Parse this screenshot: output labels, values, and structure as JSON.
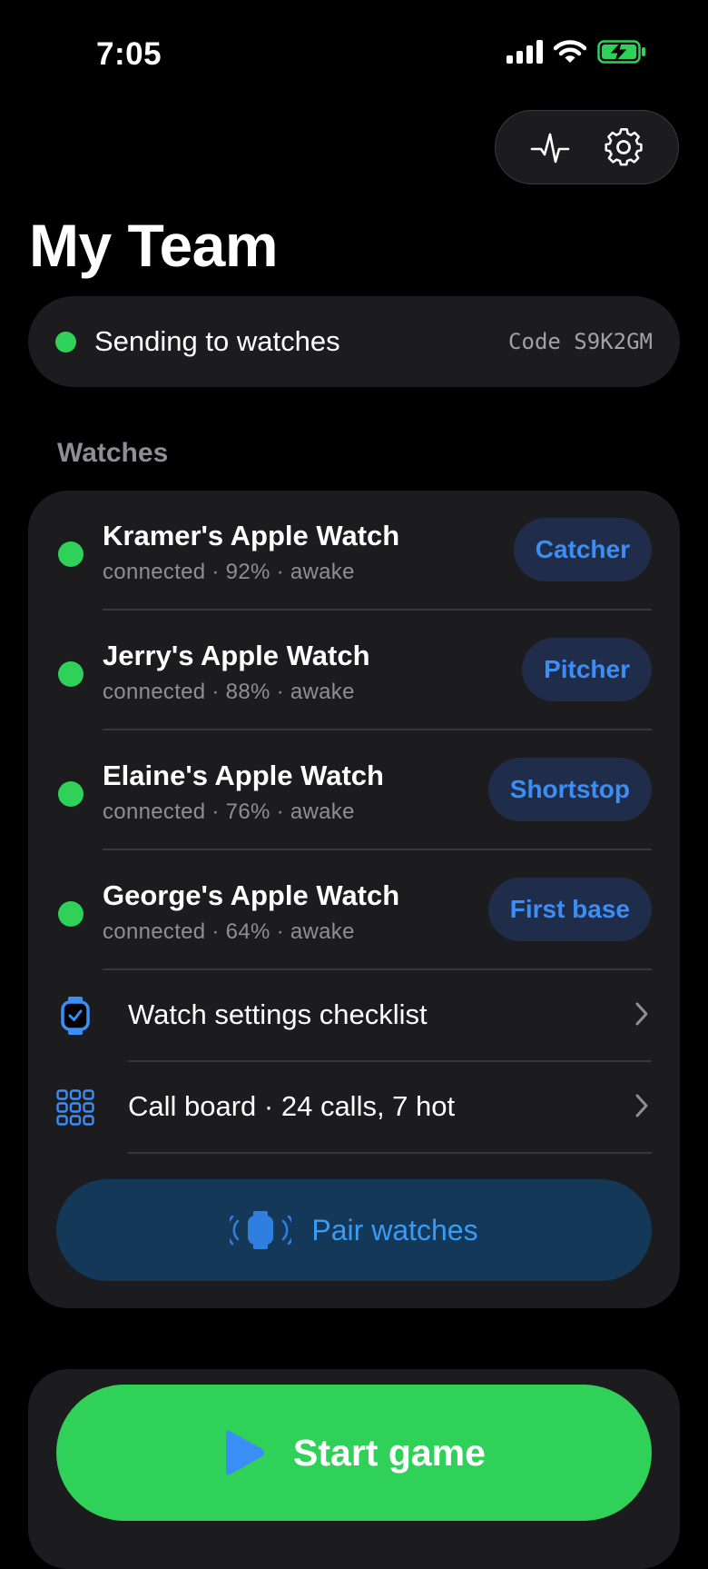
{
  "status_bar": {
    "time": "7:05"
  },
  "header": {
    "title": "My Team"
  },
  "broadcast": {
    "status": "Sending to watches",
    "code": "Code S9K2GM",
    "status_color": "#30d158"
  },
  "watches_section": {
    "label": "Watches",
    "items": [
      {
        "name": "Kramer's Apple Watch",
        "detail": "connected · 92% · awake",
        "role": "Catcher"
      },
      {
        "name": "Jerry's Apple Watch",
        "detail": "connected · 88% · awake",
        "role": "Pitcher"
      },
      {
        "name": "Elaine's Apple Watch",
        "detail": "connected · 76% · awake",
        "role": "Shortstop"
      },
      {
        "name": "George's Apple Watch",
        "detail": "connected · 64% · awake",
        "role": "First base"
      }
    ],
    "links": [
      {
        "label": "Watch settings checklist",
        "icon": "watch-check-icon"
      },
      {
        "label": "Call board · 24 calls, 7 hot",
        "icon": "grid-icon"
      }
    ],
    "pair_label": "Pair watches"
  },
  "actions": {
    "start_label": "Start game"
  },
  "colors": {
    "accent": "#3a8ef6",
    "green": "#30d158",
    "card": "#1c1c1e"
  }
}
